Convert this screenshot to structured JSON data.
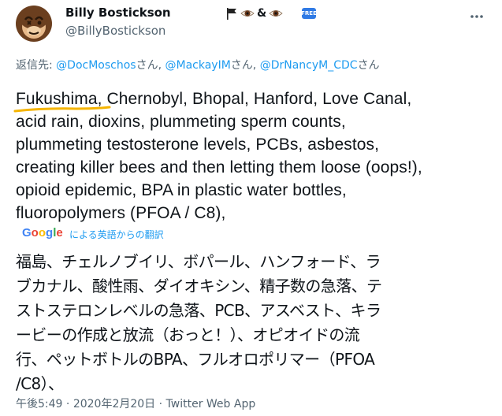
{
  "author": {
    "display_name": "Billy Bostickson",
    "handle": "@BillyBostickson",
    "name_emoji": "🏴👁&👁",
    "badge": "FREE",
    "avatar_icon": "monkey-face-icon"
  },
  "reply": {
    "prefix": "返信先: ",
    "mentions": [
      {
        "handle": "@DocMoschos",
        "suffix": "さん, "
      },
      {
        "handle": "@MackayIM",
        "suffix": "さん, "
      },
      {
        "handle": "@DrNancyM_CDC",
        "suffix": "さん"
      }
    ]
  },
  "tweet": {
    "text_lines": [
      "Fukushima, Chernobyl, Bhopal, Hanford, Love Canal,",
      "acid rain, dioxins, plummeting sperm counts,",
      "plummeting testosterone levels, PCBs, asbestos,",
      "creating killer bees and then letting them loose (oops!),",
      "opioid epidemic, BPA in plastic water bottles,",
      "fluoropolymers (PFOA / C8),"
    ],
    "highlight_color": "#f5b400"
  },
  "translation": {
    "google_label": "Google",
    "label": "による英語からの翻訳",
    "lines": [
      "福島、チェルノブイリ、ボパール、ハンフォード、ラ",
      "ブカナル、酸性雨、ダイオキシン、精子数の急落、テ",
      "ストステロンレベルの急落、PCB、アスベスト、キラ",
      "ービーの作成と放流（おっと！）、オピオイドの流",
      "行、ペットボトルのBPA、フルオロポリマー（PFOA",
      "/C8）、"
    ]
  },
  "meta": {
    "time": "午後5:49",
    "sep": " · ",
    "date": "2020年2月20日",
    "source": "Twitter Web App"
  },
  "colors": {
    "link": "#1d9bf0",
    "secondary": "#536471",
    "text": "#0f1419"
  }
}
